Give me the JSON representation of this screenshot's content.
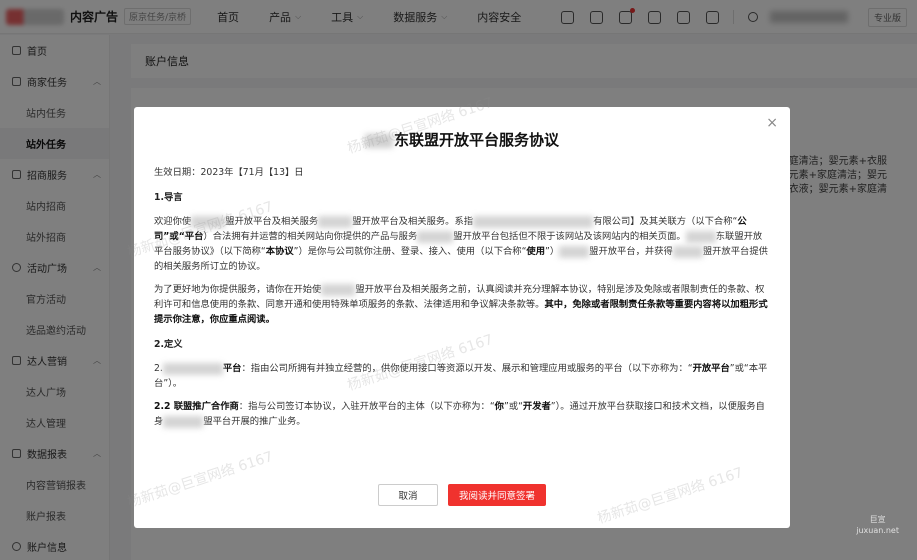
{
  "topbar": {
    "brand": "内容广告",
    "brand_sub": "原京任务/京桥",
    "nav": [
      {
        "label": "首页",
        "has_dropdown": false
      },
      {
        "label": "产品",
        "has_dropdown": true
      },
      {
        "label": "工具",
        "has_dropdown": true
      },
      {
        "label": "数据服务",
        "has_dropdown": true
      },
      {
        "label": "内容安全",
        "has_dropdown": false
      }
    ],
    "account_badge": "专业版"
  },
  "sidebar": {
    "items": [
      {
        "label": "首页",
        "type": "group",
        "icon": "home-icon"
      },
      {
        "label": "商家任务",
        "type": "group",
        "icon": "task-icon",
        "expanded": true
      },
      {
        "label": "站内任务",
        "type": "sub"
      },
      {
        "label": "站外任务",
        "type": "sub",
        "active": true
      },
      {
        "label": "招商服务",
        "type": "group",
        "icon": "tag-icon",
        "expanded": true
      },
      {
        "label": "站内招商",
        "type": "sub"
      },
      {
        "label": "站外招商",
        "type": "sub"
      },
      {
        "label": "活动广场",
        "type": "group",
        "icon": "clock-icon",
        "expanded": true
      },
      {
        "label": "官方活动",
        "type": "sub"
      },
      {
        "label": "选品邀约活动",
        "type": "sub"
      },
      {
        "label": "达人营销",
        "type": "group",
        "icon": "heart-icon",
        "expanded": true
      },
      {
        "label": "达人广场",
        "type": "sub"
      },
      {
        "label": "达人管理",
        "type": "sub"
      },
      {
        "label": "数据报表",
        "type": "group",
        "icon": "chart-icon",
        "expanded": true
      },
      {
        "label": "内容营销报表",
        "type": "sub"
      },
      {
        "label": "账户报表",
        "type": "sub"
      },
      {
        "label": "账户信息",
        "type": "group",
        "icon": "user-icon"
      }
    ]
  },
  "main": {
    "header": "账户信息",
    "bg_lines": [
      "家庭清洁；婴元素+衣服",
      "元素+家庭清洁；婴元",
      "衣液；婴元素+家庭清"
    ]
  },
  "modal": {
    "title": "东联盟开放平台服务协议",
    "effective_date": "生效日期：2023年【71月【13】日",
    "sections": {
      "s1_title": "1.导言",
      "s1_p1_a": "欢迎你使",
      "s1_p1_b": "盟开放平台及相关服务",
      "s1_p1_c": "盟开放平台及相关服务。系指",
      "s1_p1_d": "有限公司】及其关联方（以下合称“",
      "s1_p1_e": "公司”或“平台",
      "s1_p1_f": "）合法拥有并运营的相关网站向你提供的产品与服务",
      "s1_p1_g": "盟开放平台包括但不限于该网站及该网站内的相关页面。",
      "s1_p1_h": "东联",
      "s1_p1_i": "盟开放平台服务协议》（以下简称“",
      "s1_p1_j": "本协议",
      "s1_p1_k": "”）是你与公司就你注册、登录、接入、使用（以下合称“",
      "s1_p1_l": "使用",
      "s1_p1_m": "”）",
      "s1_p1_n": "盟开放平台，并获得",
      "s1_p1_o": "盟开放平台提供的相关服务所订立的协议。",
      "s1_p2_a": "为了更好地为你提供服务，请你在开始使",
      "s1_p2_b": "盟开放平台及相关服务之前，认真阅读并充分理解本协议，特别是涉及免除或者限制责任的条款、权利许可和信息使用的条款、同意开通和使用特殊单项服务的条款、法律适用和争议解决条款等。",
      "s1_p2_c": "其中，免除或者限制责任条款等重要内容将以加粗形式提示你注意，你应重点阅读。",
      "s2_title": "2.定义",
      "s2_1_a": "2.",
      "s2_1_b": "平台",
      "s2_1_c": "：指由公司所拥有并独立经营的，供你使用接口等资源以开发、展示和管理应用或服务的平台（以下亦称为：“",
      "s2_1_d": "开放平台",
      "s2_1_e": "”或“本平台",
      "s2_1_f": "”）。",
      "s2_2_a": "2.2 联盟推广合作商",
      "s2_2_b": "：指与公司签订本协议，入驻开放平台的主体（以下亦称为：“",
      "s2_2_c": "你",
      "s2_2_d": "”或“",
      "s2_2_e": "开发者",
      "s2_2_f": "”）。通过开放平台获取接口和技术文档，以便服务自身",
      "s2_2_g": "盟平台开展的推广业务。"
    },
    "cancel_label": "取消",
    "agree_label": "我阅读并同意签署",
    "close_symbol": "×"
  },
  "watermark": "杨新茹@巨宣网络 6167",
  "corner_logo": {
    "line1": "巨宣",
    "line2": "juxuan.net"
  }
}
